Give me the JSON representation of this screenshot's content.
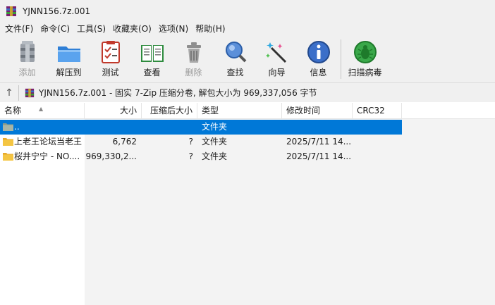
{
  "window": {
    "title": "YJNN156.7z.001"
  },
  "menu": [
    "文件(F)",
    "命令(C)",
    "工具(S)",
    "收藏夹(O)",
    "选项(N)",
    "帮助(H)"
  ],
  "toolbar": {
    "add": "添加",
    "extract": "解压到",
    "test": "测试",
    "view": "查看",
    "delete": "删除",
    "find": "查找",
    "wizard": "向导",
    "info": "信息",
    "scan": "扫描病毒"
  },
  "address": {
    "text": "YJNN156.7z.001 - 固实 7-Zip 压缩分卷, 解包大小为 969,337,056 字节"
  },
  "columns": {
    "name": "名称",
    "size": "大小",
    "packed": "压缩后大小",
    "type": "类型",
    "modified": "修改时间",
    "crc": "CRC32"
  },
  "rows": [
    {
      "name": "..",
      "size": "",
      "packed": "",
      "type": "文件夹",
      "modified": "",
      "crc": ""
    },
    {
      "name": "上老王论坛当老王",
      "size": "6,762",
      "packed": "?",
      "type": "文件夹",
      "modified": "2025/7/11 14...",
      "crc": ""
    },
    {
      "name": "桜井宁宁 - NO....",
      "size": "969,330,2...",
      "packed": "?",
      "type": "文件夹",
      "modified": "2025/7/11 14...",
      "crc": ""
    }
  ],
  "colors": {
    "selection": "#0078d7",
    "folder": "#f4c542",
    "chrome": "#f0f0f0"
  }
}
